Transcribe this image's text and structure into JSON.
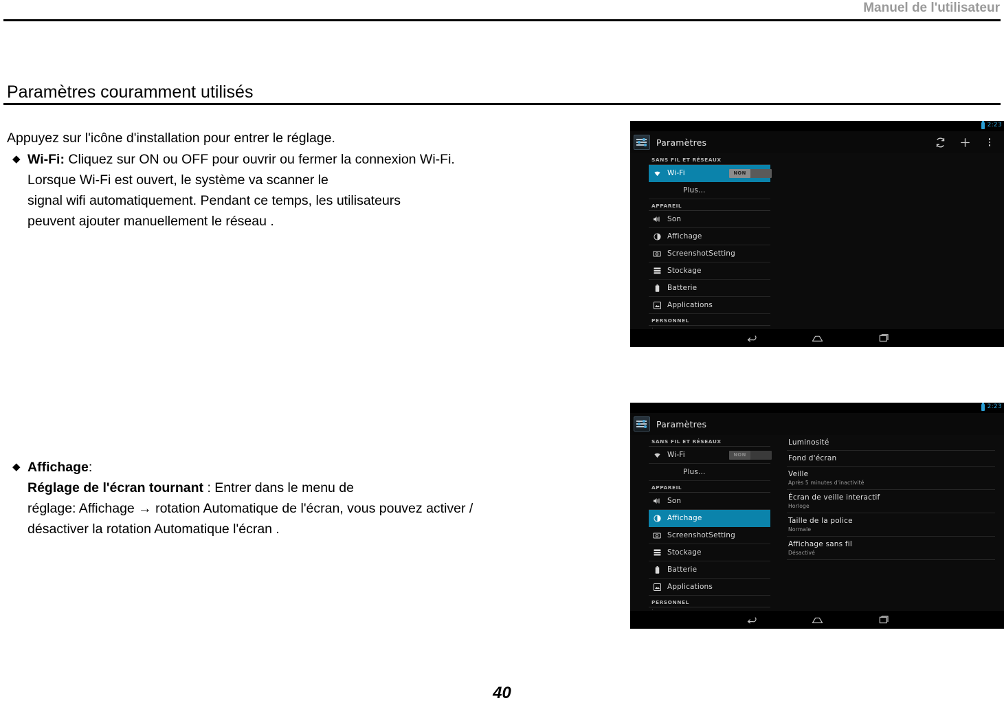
{
  "page": {
    "header_title": "Manuel de l'utilisateur",
    "section_heading": "Paramètres couramment utilisés",
    "page_number": "40"
  },
  "body": {
    "intro": "Appuyez sur l'icône d'installation pour entrer le réglage.",
    "bullet_glyph": "◆",
    "wifi": {
      "term": "Wi-Fi:",
      "line1_rest": " Cliquez sur ON ou OFF pour ouvrir ou fermer la connexion Wi-Fi.",
      "line2": "Lorsque Wi-Fi est ouvert, le système va scanner le",
      "line3": "signal wifi automatiquement. Pendant ce temps, les utilisateurs",
      "line4": "peuvent ajouter manuellement le réseau ."
    },
    "display": {
      "term": "Affichage",
      "term_suffix": ":",
      "line2_bold": "Réglage de l'écran tournant",
      "line2_rest": " : Entrer dans le menu de",
      "line3": "réglage: Affichage → rotation Automatique de l'écran, vous pouvez activer /",
      "line4": "désactiver la rotation Automatique l'écran ."
    }
  },
  "colors": {
    "accent_blue": "#0b83ab",
    "status_cyan": "#2a9fd6",
    "actionbar_rule": "#2196c4",
    "header_gray": "#9a9a9a"
  },
  "screenshot_wifi": {
    "status": {
      "time": "2:23",
      "battery_icon": "battery-icon"
    },
    "actionbar": {
      "app_icon": "settings-sliders-icon",
      "title": "Paramètres",
      "actions": [
        {
          "name": "sync-icon",
          "label": ""
        },
        {
          "name": "add-icon",
          "label": ""
        },
        {
          "name": "overflow-menu-icon",
          "label": ""
        }
      ]
    },
    "groups": [
      {
        "label": "SANS FIL ET RÉSEAUX",
        "items": [
          {
            "label": "Wi-Fi",
            "icon": "wifi-icon",
            "selected": true,
            "toggle": "NON",
            "toggle_state": "on-bright"
          },
          {
            "label": "Plus...",
            "icon": "none",
            "selected": false,
            "indent": true
          }
        ]
      },
      {
        "label": "APPAREIL",
        "items": [
          {
            "label": "Son",
            "icon": "volume-icon",
            "selected": false
          },
          {
            "label": "Affichage",
            "icon": "brightness-icon",
            "selected": false
          },
          {
            "label": "ScreenshotSetting",
            "icon": "camera-icon",
            "selected": false
          },
          {
            "label": "Stockage",
            "icon": "storage-icon",
            "selected": false
          },
          {
            "label": "Batterie",
            "icon": "battery-list-icon",
            "selected": false
          },
          {
            "label": "Applications",
            "icon": "apps-icon",
            "selected": false
          }
        ]
      },
      {
        "label": "PERSONNEL",
        "items": []
      }
    ],
    "right_pane": [],
    "navbar": [
      {
        "name": "back-icon"
      },
      {
        "name": "home-icon"
      },
      {
        "name": "recents-icon"
      }
    ]
  },
  "screenshot_display": {
    "status": {
      "time": "2:23",
      "battery_icon": "battery-icon"
    },
    "actionbar": {
      "app_icon": "settings-sliders-icon",
      "title": "Paramètres",
      "actions": []
    },
    "groups": [
      {
        "label": "SANS FIL ET RÉSEAUX",
        "items": [
          {
            "label": "Wi-Fi",
            "icon": "wifi-icon",
            "selected": false,
            "toggle": "NON",
            "toggle_state": "dim"
          },
          {
            "label": "Plus...",
            "icon": "none",
            "selected": false,
            "indent": true
          }
        ]
      },
      {
        "label": "APPAREIL",
        "items": [
          {
            "label": "Son",
            "icon": "volume-icon",
            "selected": false
          },
          {
            "label": "Affichage",
            "icon": "brightness-icon",
            "selected": true
          },
          {
            "label": "ScreenshotSetting",
            "icon": "camera-icon",
            "selected": false
          },
          {
            "label": "Stockage",
            "icon": "storage-icon",
            "selected": false
          },
          {
            "label": "Batterie",
            "icon": "battery-list-icon",
            "selected": false
          },
          {
            "label": "Applications",
            "icon": "apps-icon",
            "selected": false
          }
        ]
      },
      {
        "label": "PERSONNEL",
        "items": []
      }
    ],
    "right_pane": [
      {
        "title": "Luminosité",
        "sub": ""
      },
      {
        "title": "Fond d'écran",
        "sub": ""
      },
      {
        "title": "Veille",
        "sub": "Après 5 minutes d'inactivité"
      },
      {
        "title": "Écran de veille interactif",
        "sub": "Horloge"
      },
      {
        "title": "Taille de la police",
        "sub": "Normale"
      },
      {
        "title": "Affichage sans fil",
        "sub": "Désactivé"
      }
    ],
    "navbar": [
      {
        "name": "back-icon"
      },
      {
        "name": "home-icon"
      },
      {
        "name": "recents-icon"
      }
    ]
  }
}
